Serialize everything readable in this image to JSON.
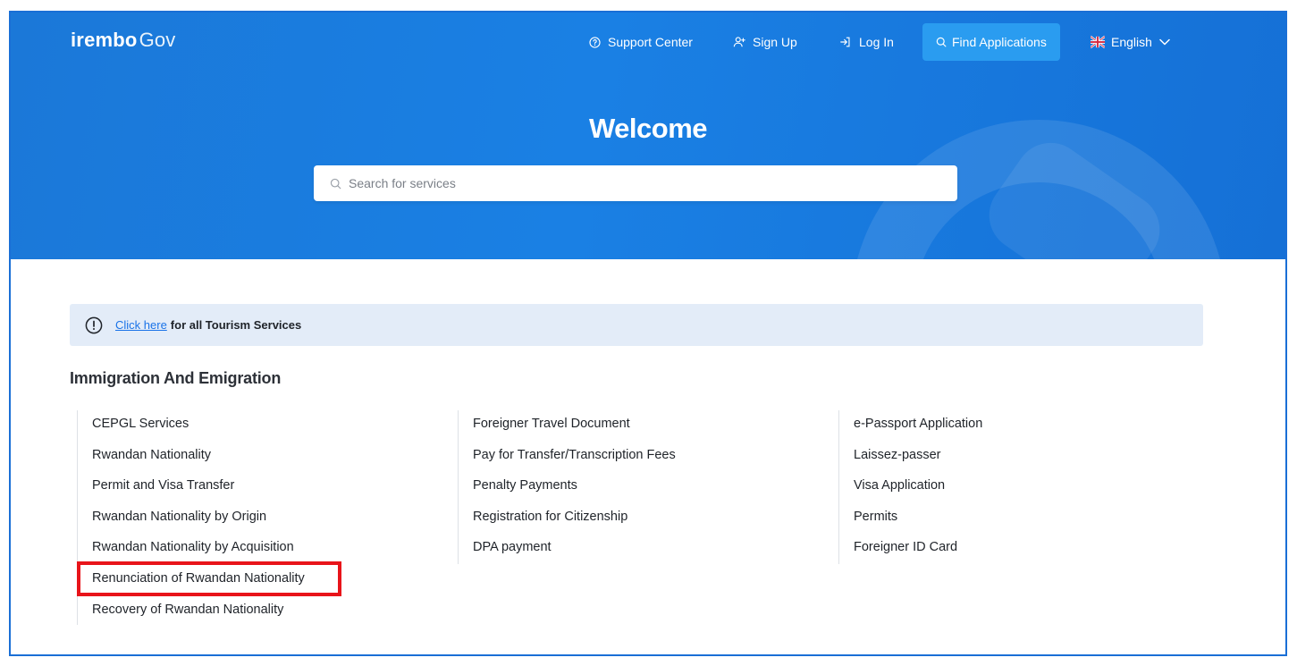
{
  "header": {
    "logo_brand": "irembo",
    "logo_suffix": "Gov",
    "nav": {
      "support_label": "Support Center",
      "signup_label": "Sign Up",
      "login_label": "Log In",
      "find_label": "Find Applications",
      "language_label": "English"
    }
  },
  "hero": {
    "title": "Welcome",
    "search_placeholder": "Search for services"
  },
  "alert": {
    "link_text": "Click here",
    "text": "for all Tourism Services"
  },
  "section": {
    "title": "Immigration And Emigration",
    "columns": [
      [
        "CEPGL Services",
        "Rwandan Nationality",
        "Permit and Visa Transfer",
        "Rwandan Nationality by Origin",
        "Rwandan Nationality by Acquisition",
        "Renunciation of Rwandan Nationality",
        "Recovery of Rwandan Nationality"
      ],
      [
        "Foreigner Travel Document",
        "Pay for Transfer/Transcription Fees",
        "Penalty Payments",
        "Registration for Citizenship",
        "DPA payment"
      ],
      [
        "e-Passport Application",
        "Laissez-passer",
        "Visa Application",
        "Permits",
        "Foreigner ID Card"
      ]
    ]
  },
  "colors": {
    "hero_blue": "#1a80e4",
    "find_button": "#2a9cf0",
    "highlight_box": "#e8141a",
    "alert_bg": "#e3ecf8",
    "link": "#1a73e8"
  }
}
